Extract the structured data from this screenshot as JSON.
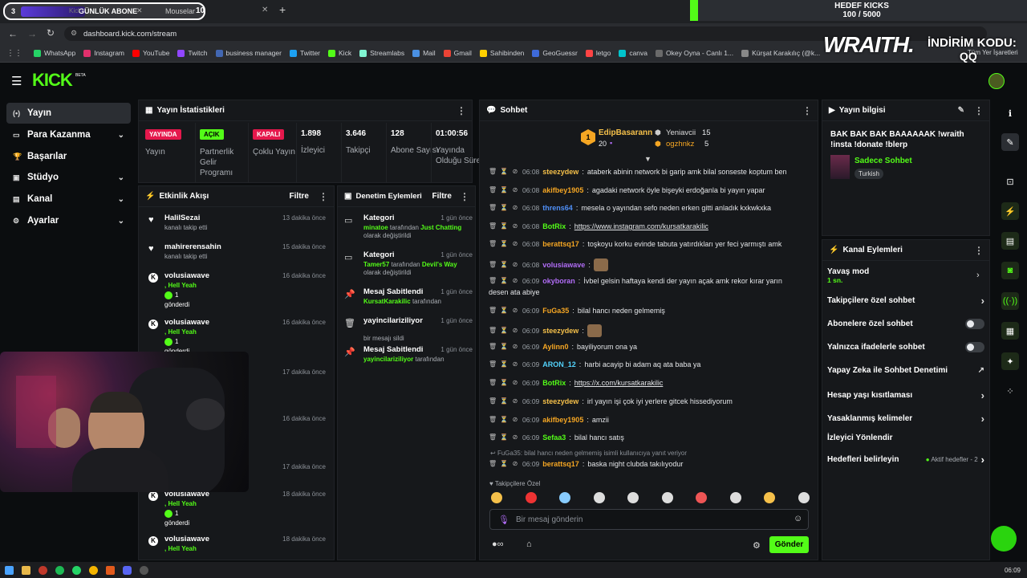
{
  "browser": {
    "tab1_counter": "3",
    "tab1_overlay": "GÜNLÜK ABONE",
    "tab1_label": "Kick",
    "tab2_label": "Mouselar",
    "tab2_counter": "10",
    "url": "dashboard.kick.com/stream",
    "bookmarks": [
      "WhatsApp",
      "Instagram",
      "YouTube",
      "Twitch",
      "business manager",
      "Twitter",
      "Kick",
      "Streamlabs",
      "Mail",
      "Gmail",
      "Sahibinden",
      "GeoGuessr",
      "letgo",
      "canva",
      "Okey Oyna - Canlı 1...",
      "Kürşat Karakılıç (@k..."
    ],
    "bookmarks_more": "Tüm Yer İşaretleri"
  },
  "overlay": {
    "goal_title": "HEDEF KICKS",
    "goal_value": "100 / 5000",
    "goal_progress": 0.02,
    "brand": "WRAITH.",
    "promo_label": "İNDİRİM KODU:",
    "promo_code": "QQ"
  },
  "app": {
    "logo": "KICK",
    "beta": "BETA",
    "colors": {
      "accent": "#53fc18",
      "bg": "#0b0d0f",
      "panel": "#16181b"
    }
  },
  "nav": [
    {
      "label": "Yayın",
      "icon": "live-icon"
    },
    {
      "label": "Para Kazanma",
      "icon": "money-icon"
    },
    {
      "label": "Başarılar",
      "icon": "trophy-icon"
    },
    {
      "label": "Stüdyo",
      "icon": "studio-icon"
    },
    {
      "label": "Kanal",
      "icon": "channel-icon"
    },
    {
      "label": "Ayarlar",
      "icon": "gear-icon"
    }
  ],
  "stats": {
    "title": "Yayın İstatistikleri",
    "items": [
      {
        "badge": "YAYINDA",
        "label": "Yayın"
      },
      {
        "badge": "AÇIK",
        "label": "Partnerlik Gelir Programı"
      },
      {
        "badge": "KAPALI",
        "label": "Çoklu Yayın"
      },
      {
        "value": "1.898",
        "label": "İzleyici"
      },
      {
        "value": "3.646",
        "label": "Takipçi"
      },
      {
        "value": "128",
        "label": "Abone Sayısı"
      },
      {
        "value": "01:00:56",
        "label": "Yayında Olduğu Süre"
      }
    ]
  },
  "activity": {
    "title": "Etkinlik Akışı",
    "filter": "Filtre",
    "items": [
      {
        "name": "HalilSezai",
        "sub": "kanalı takip etti",
        "time": "13 dakika önce"
      },
      {
        "name": "mahirerensahin",
        "sub": "kanalı takip etti",
        "time": "15 dakika önce"
      },
      {
        "name": "volusiawave",
        "sub": ", Hell Yeah",
        "count": "1",
        "sub2": "gönderdi",
        "time": "16 dakika önce"
      },
      {
        "name": "volusiawave",
        "sub": ", Hell Yeah",
        "count": "1",
        "sub2": "gönderdi",
        "time": "16 dakika önce"
      },
      {
        "time": "17 dakika önce"
      },
      {
        "time": "16 dakika önce"
      },
      {
        "time": "17 dakika önce"
      },
      {
        "name": "volusiawave",
        "sub": ", Hell Yeah",
        "count": "1",
        "sub2": "gönderdi",
        "time": "18 dakika önce"
      },
      {
        "name": "volusiawave",
        "sub": ", Hell Yeah",
        "time": "18 dakika önce"
      }
    ]
  },
  "moderation": {
    "title": "Denetim Eylemleri",
    "filter": "Filtre",
    "items": [
      {
        "title": "Kategori",
        "time": "1 gün önce",
        "user": "minatoe",
        "mid": "tarafından",
        "target": "Just Chatting",
        "rest": "olarak değiştirildi"
      },
      {
        "title": "Kategori",
        "time": "1 gün önce",
        "user": "Tamer57",
        "mid": "tarafından",
        "target": "Devil's Way",
        "rest": "olarak değiştirildi"
      },
      {
        "title": "Mesaj Sabitlendi",
        "time": "1 gün önce",
        "user": "KursatKarakilic",
        "mid": "tarafından"
      },
      {
        "title": "yayincilariziliyor",
        "time": "1 gün önce",
        "rest": "bir mesajı sildi"
      },
      {
        "title": "Mesaj Sabitlendi",
        "time": "1 gün önce",
        "user": "yayincilariziliyor",
        "mid": "tarafından"
      }
    ]
  },
  "chat": {
    "title": "Sohbet",
    "top": {
      "name": "EdipBasarann",
      "rank": "1",
      "count": "20",
      "second": "Yeniavcii",
      "second_count": "15",
      "third": "ogzhnkz",
      "third_count": "5"
    },
    "messages": [
      {
        "time": "06:08",
        "user": "steezydew",
        "color": "#f5c04a",
        "text": "ataberk abinin network bi garip amk bilal sonseste koptum ben"
      },
      {
        "time": "06:08",
        "user": "akifbey1905",
        "color": "#f5a623",
        "text": "agadaki network öyle bişeyki erdoğanla bi yayın yapar"
      },
      {
        "time": "06:08",
        "user": "threns64",
        "color": "#4f8ff7",
        "text": "mesela o yayından sefo neden erken gitti anladık kxkwkxka"
      },
      {
        "time": "06:08",
        "user": "BotRix",
        "color": "#53fc18",
        "text": "https://www.instagram.com/kursatkarakilic"
      },
      {
        "time": "06:08",
        "user": "berattsq17",
        "color": "#f5a623",
        "text": "toşkoyu korku evinde tabuta yatırdıkları yer feci yarmıştı amk"
      },
      {
        "time": "06:08",
        "user": "volusiawave",
        "color": "#b06cf5",
        "text": ""
      },
      {
        "time": "06:09",
        "user": "okyboran",
        "color": "#b06cf5",
        "text": "İvbel gelsin haftaya kendi der yayın açak amk rekor kırar yarın",
        "text2": "desen ata abiye"
      },
      {
        "time": "06:09",
        "user": "FuGa35",
        "color": "#f5a623",
        "text": "bilal hancı neden gelmemiş"
      },
      {
        "time": "06:09",
        "user": "steezydew",
        "color": "#f5c04a",
        "text": ""
      },
      {
        "time": "06:09",
        "user": "Aylinn0",
        "color": "#f5a623",
        "text": "bayiliyorum ona ya"
      },
      {
        "time": "06:09",
        "user": "ARON_12",
        "color": "#53d3fc",
        "text": "harbi acayip bi adam aq ata baba ya"
      },
      {
        "time": "06:09",
        "user": "BotRix",
        "color": "#53fc18",
        "text": "https://x.com/kursatkarakilic"
      },
      {
        "time": "06:09",
        "user": "steezydew",
        "color": "#f5c04a",
        "text": "irl yayın işi çok iyi yerlere gitcek hissediyorum"
      },
      {
        "time": "06:09",
        "user": "akifbey1905",
        "color": "#f5a623",
        "text": "amzii"
      },
      {
        "time": "06:09",
        "user": "Sefaa3",
        "color": "#53fc18",
        "text": "bilal hancı satış"
      }
    ],
    "reply_note": "FuGa35: bilal hancı neden gelmemiş isimli kullanıcıya yanıt veriyor",
    "last": {
      "time": "06:09",
      "user": "berattsq17",
      "color": "#f5a623",
      "text": "baska night clubda takılıyodur"
    },
    "followers_only": "Takipçilere Özel",
    "input_placeholder": "Bir mesaj gönderin",
    "send": "Gönder"
  },
  "info": {
    "title": "Yayın bilgisi",
    "stream_title": "BAK BAK BAK BAAAAAAK !wraith !insta !donate !blerp",
    "category": "Sadece Sohbet",
    "language": "Turkish"
  },
  "channel_actions": {
    "title": "Kanal Eylemleri",
    "slow_mode": "Yavaş mod",
    "slow_value": "1 sn.",
    "followers_chat": "Takipçilere özel sohbet",
    "subs_chat": "Abonelere özel sohbet",
    "emote_chat": "Yalnızca ifadelerle sohbet",
    "ai_mod": "Yapay Zeka ile Sohbet Denetimi",
    "age": "Hesap yaşı kısıtlaması",
    "banned": "Yasaklanmış kelimeler",
    "redirect": "İzleyici Yönlendir",
    "goals": "Hedefleri belirleyin",
    "goals_status": "Aktif hedefler - 2"
  },
  "taskbar": {
    "clock": "06:09"
  }
}
